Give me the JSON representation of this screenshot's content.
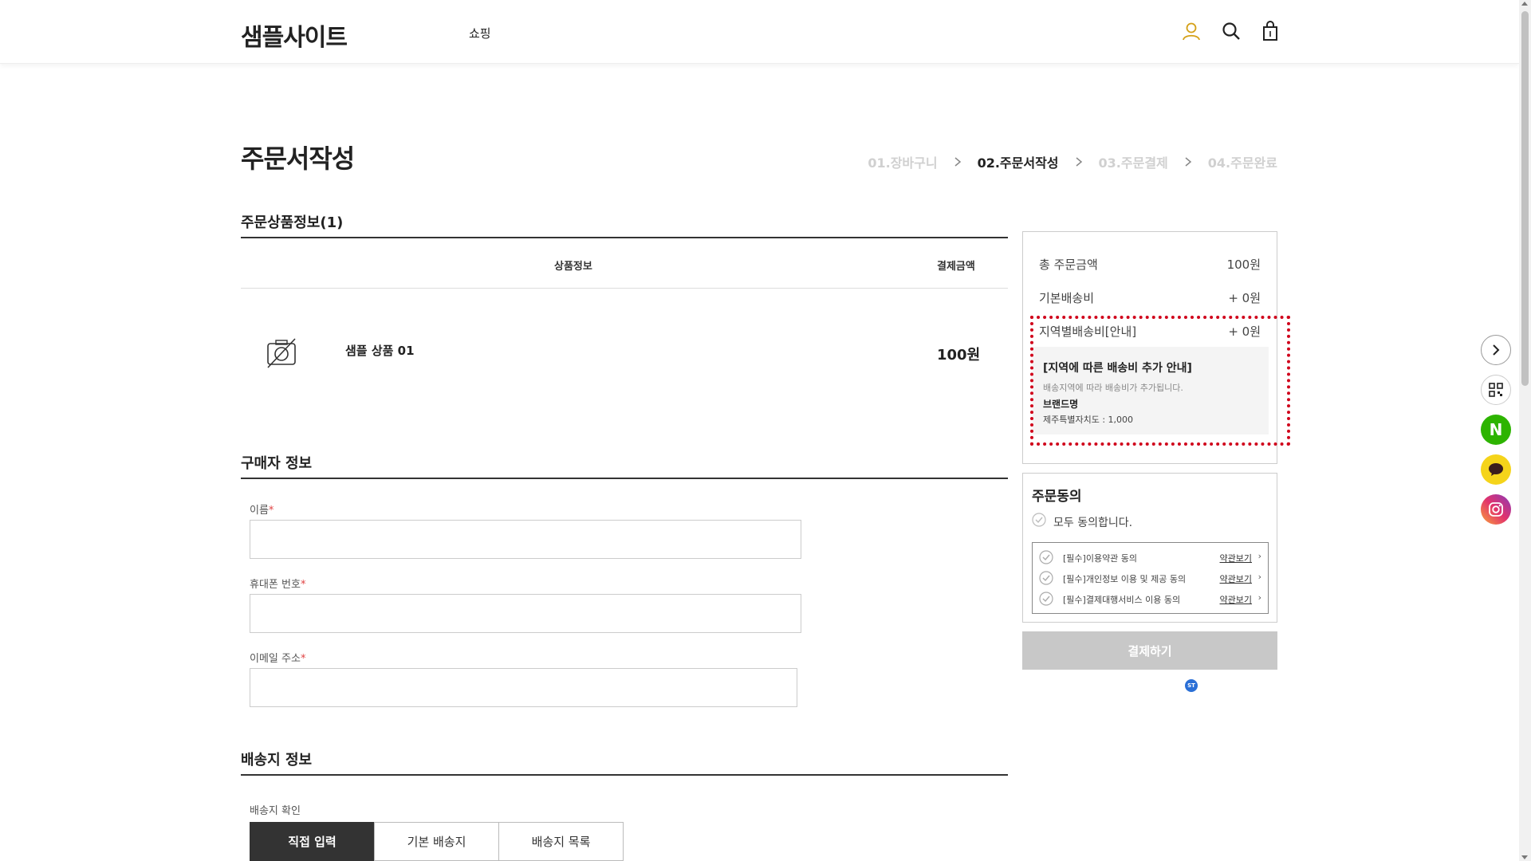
{
  "header": {
    "logo": "샘플사이트",
    "nav_shop": "쇼핑"
  },
  "page": {
    "title": "주문서작성"
  },
  "steps": [
    {
      "label": "01.장바구니"
    },
    {
      "label": "02.주문서작성"
    },
    {
      "label": "03.주문결제"
    },
    {
      "label": "04.주문완료"
    }
  ],
  "order_items": {
    "title": "주문상품정보(1)",
    "col_product": "상품정보",
    "col_price": "결제금액",
    "product_name": "샘플 상품 01",
    "product_price": "100원"
  },
  "buyer": {
    "title": "구매자 정보",
    "name_label": "이름",
    "phone_label": "휴대폰 번호",
    "email_label": "이메일 주소",
    "required_mark": "*",
    "name_value": "",
    "phone_value": "",
    "email_value": ""
  },
  "shipping": {
    "title": "배송지 정보",
    "confirm_label": "배송지 확인",
    "tabs": [
      {
        "label": "직접 입력"
      },
      {
        "label": "기본 배송지"
      },
      {
        "label": "배송지 목록"
      }
    ]
  },
  "summary": {
    "total_label": "총 주문금액",
    "total_value": "100원",
    "base_ship_label": "기본배송비",
    "base_ship_value": "+ 0원",
    "region_ship_label": "지역별배송비[안내]",
    "region_ship_value": "+ 0원",
    "notice_title": "[지역에 따른 배송비 추가 안내]",
    "notice_desc": "배송지역에 따라 배송비가 추가됩니다.",
    "notice_brand": "브랜드명",
    "notice_region": "제주특별자치도 : 1,000"
  },
  "agreement": {
    "title": "주문동의",
    "all_label": "모두 동의합니다.",
    "items": [
      {
        "label": "[필수]이용약관 동의",
        "link": "약관보기"
      },
      {
        "label": "[필수]개인정보 이용 및 제공 동의",
        "link": "약관보기"
      },
      {
        "label": "[필수]결제대행서비스 이용 동의",
        "link": "약관보기"
      }
    ]
  },
  "pay_button": "결제하기",
  "badge": "ST",
  "floating": {
    "naver": "N"
  },
  "colors": {
    "accent_user": "#d4a017",
    "required": "#e04343",
    "highlight_frame": "#d0021b",
    "pay_disabled": "#c8c8c8",
    "naver": "#2db400",
    "talk": "#f5d41a"
  }
}
